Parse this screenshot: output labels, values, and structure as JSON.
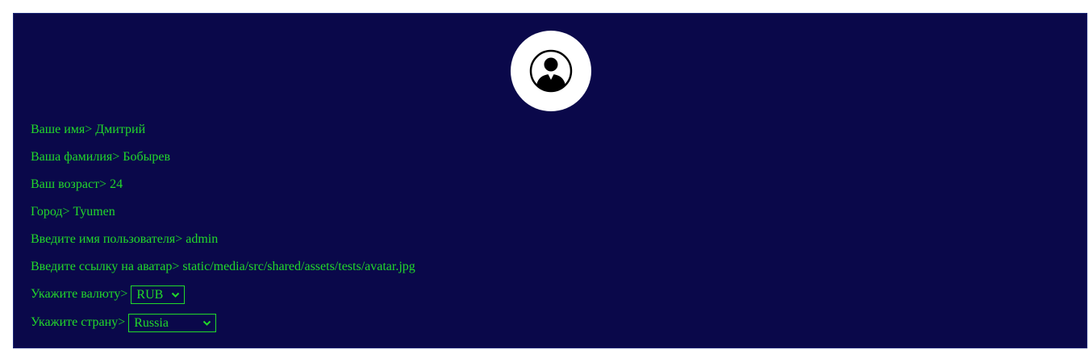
{
  "profile": {
    "avatar_icon": "user-avatar-icon",
    "fields": [
      {
        "label": "Ваше имя>",
        "value": "Дмитрий"
      },
      {
        "label": "Ваша фамилия>",
        "value": "Бобырев"
      },
      {
        "label": "Ваш возраст>",
        "value": "24"
      },
      {
        "label": "Город>",
        "value": "Tyumen"
      },
      {
        "label": "Введите имя пользователя>",
        "value": "admin"
      },
      {
        "label": "Введите ссылку на аватар>",
        "value": "static/media/src/shared/assets/tests/avatar.jpg"
      }
    ],
    "currency": {
      "label": "Укажите валюту>",
      "selected": "RUB"
    },
    "country": {
      "label": "Укажите страну>",
      "selected": "Russia"
    }
  },
  "colors": {
    "background": "#0a084a",
    "text": "#22d92a",
    "avatar_bg": "#ffffff"
  }
}
